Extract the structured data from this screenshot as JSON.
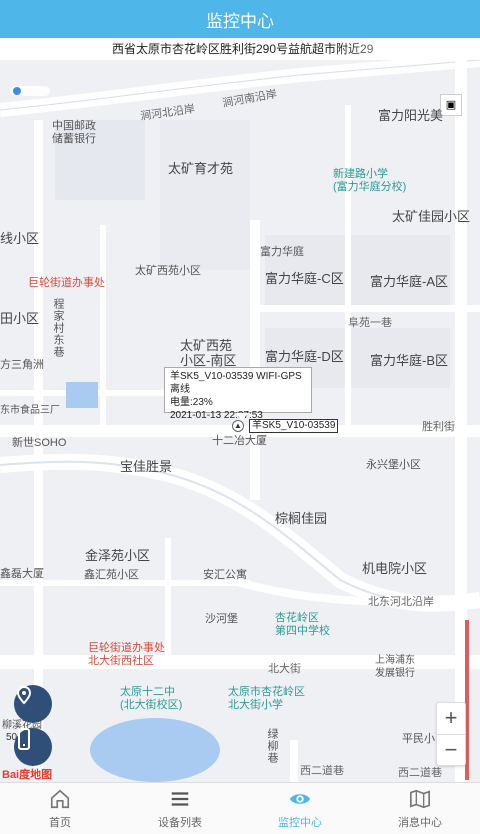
{
  "header": {
    "title": "监控中心"
  },
  "address": {
    "text": "西省太原市杏花岭区胜利街290号益航超市附近29"
  },
  "map": {
    "labels": {
      "jianhe_north": "涧河北沿岸",
      "jianhe_south": "涧河南沿岸",
      "post": "中国邮政\n储蓄银行",
      "fuli_sunny": "富力阳光美",
      "taikuang_yucai": "太矿育才苑",
      "xinjianlu": "新建路小学\n(富力华庭分校)",
      "taikuang_jiayuan": "太矿佳园小区",
      "xian_xiaoqu": "线小区",
      "fuli_huating": "富力华庭",
      "jielun_office": "巨轮街道办事处",
      "taikuang_xiyuan": "太矿西苑小区",
      "fuli_c": "富力华庭-C区",
      "fuli_a": "富力华庭-A区",
      "tian_xiaoqu": "田小区",
      "chengjia": "程家村东巷",
      "fuyuan": "阜苑一巷",
      "taikuang_south": "太矿西苑\n小区-南区",
      "fuli_d": "富力华庭-D区",
      "fuli_b": "富力华庭-B区",
      "sanjiaozhou": "方三角洲",
      "food_factory": "东市食品三厂",
      "xinshijie": "新世SOHO",
      "shierye": "十二冶大厦",
      "shengli_street": "胜利街",
      "baoxin": "宝佳胜景",
      "yongxing": "永兴堡小区",
      "zonglv": "棕榈佳园",
      "jinze": "金泽苑小区",
      "jidian": "机电院小区",
      "xinhui": "鑫汇苑小区",
      "anhui": "安汇公寓",
      "xinda": "鑫磊大厦",
      "beidong": "北东河北沿岸",
      "shahepu": "沙河堡",
      "xinghua_school": "杏花岭区\n第四中学校",
      "jielun_office2": "巨轮街道办事处\n北大街西社区",
      "beidajie": "北大街",
      "shanghai_bank": "上海浦东\n发展银行",
      "taiyuan12": "太原十二中\n(北大街校区)",
      "taiyuan_xinghua": "太原市杏花岭区\n北大街小学",
      "lvliu": "绿柳巷",
      "pingmin": "平民小",
      "xierdao": "西二道巷",
      "xierdao2": "西二道巷",
      "liuxiang": "柳溪花园"
    },
    "popup": {
      "line1": "羊SK5_V10-03539 WIFI-GPS 离线",
      "line2": "电量:23%",
      "line3": "2021-01-13 22:37:53"
    },
    "device_label": "羊SK5_V10-03539",
    "scale": "50",
    "baidu": "Bai度地图",
    "zoom_in": "+",
    "zoom_out": "−"
  },
  "tabs": [
    {
      "label": "首页",
      "icon": "home-icon"
    },
    {
      "label": "设备列表",
      "icon": "list-icon"
    },
    {
      "label": "监控中心",
      "icon": "eye-icon"
    },
    {
      "label": "消息中心",
      "icon": "map-icon"
    }
  ],
  "colors": {
    "primary": "#4fb6ea",
    "button": "#2f4f79"
  }
}
